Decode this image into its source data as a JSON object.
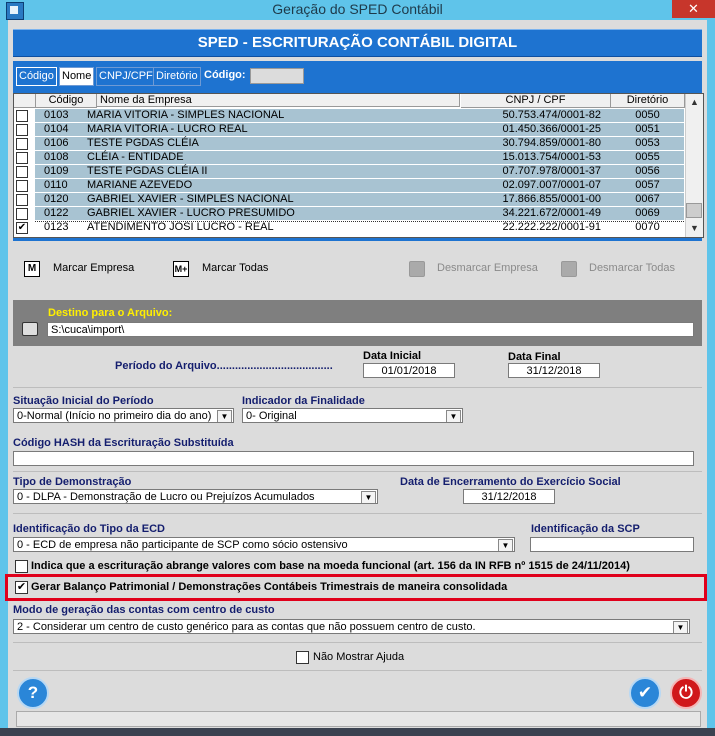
{
  "window": {
    "title": "Geração do SPED Contábil",
    "close_glyph": "✕"
  },
  "banner": "SPED - ESCRITURAÇÃO CONTÁBIL DIGITAL",
  "tabs": [
    {
      "label": "Código"
    },
    {
      "label": "Nome"
    },
    {
      "label": "CNPJ/CPF"
    },
    {
      "label": "Diretório"
    }
  ],
  "search": {
    "label": "Código:",
    "value": ""
  },
  "grid": {
    "headers": [
      "Código",
      "Nome da Empresa",
      "CNPJ / CPF",
      "Diretório"
    ],
    "rows": [
      {
        "checked": false,
        "codigo": "0103",
        "nome": "MARIA VITORIA - SIMPLES NACIONAL",
        "cnpj": "50.753.474/0001-82",
        "dir": "0050"
      },
      {
        "checked": false,
        "codigo": "0104",
        "nome": "MARIA VITORIA - LUCRO REAL",
        "cnpj": "01.450.366/0001-25",
        "dir": "0051"
      },
      {
        "checked": false,
        "codigo": "0106",
        "nome": "TESTE PGDAS CLÉIA",
        "cnpj": "30.794.859/0001-80",
        "dir": "0053"
      },
      {
        "checked": false,
        "codigo": "0108",
        "nome": "CLÉIA - ENTIDADE",
        "cnpj": "15.013.754/0001-53",
        "dir": "0055"
      },
      {
        "checked": false,
        "codigo": "0109",
        "nome": "TESTE PGDAS CLÉIA II",
        "cnpj": "07.707.978/0001-37",
        "dir": "0056"
      },
      {
        "checked": false,
        "codigo": "0110",
        "nome": "MARIANE AZEVEDO",
        "cnpj": "02.097.007/0001-07",
        "dir": "0057"
      },
      {
        "checked": false,
        "codigo": "0120",
        "nome": "GABRIEL XAVIER - SIMPLES NACIONAL",
        "cnpj": "17.866.855/0001-00",
        "dir": "0067"
      },
      {
        "checked": false,
        "codigo": "0122",
        "nome": "GABRIEL XAVIER - LUCRO PRESUMIDO",
        "cnpj": "34.221.672/0001-49",
        "dir": "0069"
      },
      {
        "checked": true,
        "codigo": "0123",
        "nome": "ATENDIMENTO JOSI LUCRO - REAL",
        "cnpj": "22.222.222/0001-91",
        "dir": "0070"
      }
    ]
  },
  "actions": {
    "marcar_empresa": "Marcar Empresa",
    "marcar_todas": "Marcar Todas",
    "desmarcar_empresa": "Desmarcar Empresa",
    "desmarcar_todas": "Desmarcar Todas",
    "m_glyph": "M",
    "mplus_glyph": "M+"
  },
  "destino": {
    "label": "Destino para o Arquivo:",
    "value": "S:\\cuca\\import\\"
  },
  "periodo": {
    "label": "Período do Arquivo......................................",
    "inicial_label": "Data Inicial",
    "inicial": "01/01/2018",
    "final_label": "Data Final",
    "final": "31/12/2018"
  },
  "situacao": {
    "label": "Situação Inicial do Período",
    "value": "0-Normal (Início no primeiro dia do ano)"
  },
  "finalidade": {
    "label": "Indicador da Finalidade",
    "value": "0- Original"
  },
  "hash": {
    "label": "Código HASH da Escrituração Substituída",
    "value": ""
  },
  "demonstracao": {
    "label": "Tipo de Demonstração",
    "value": "0 - DLPA - Demonstração de Lucro ou Prejuízos Acumulados"
  },
  "encerramento": {
    "label": "Data de Encerramento do Exercício Social",
    "value": "31/12/2018"
  },
  "ecd": {
    "label": "Identificação do Tipo da ECD",
    "value": "0 - ECD de empresa não participante de SCP como sócio ostensivo"
  },
  "scp": {
    "label": "Identificação da SCP",
    "value": ""
  },
  "moeda_funcional": {
    "label": "Indica que a escrituração abrange valores com base na moeda funcional (art. 156 da IN RFB nº 1515 de 24/11/2014)",
    "checked": false
  },
  "balanco": {
    "label": "Gerar Balanço Patrimonial / Demonstrações Contábeis Trimestrais de maneira consolidada",
    "checked": true,
    "check_glyph": "✔"
  },
  "centro_custo": {
    "label": "Modo de geração das contas com centro de custo",
    "value": "2 - Considerar um centro de custo genérico para as contas que não possuem centro de custo."
  },
  "ajuda": {
    "label": "Não Mostrar Ajuda",
    "checked": false
  },
  "footer": {
    "help_glyph": "?",
    "ok_glyph": "✔",
    "power_glyph": "⏻"
  },
  "icons": {
    "app": "sped-app-icon",
    "close": "close-icon",
    "printer": "printer-icon",
    "dropdown": "chevron-down-icon",
    "scroll_up": "chevron-up-icon",
    "scroll_down": "chevron-down-icon"
  },
  "colors": {
    "title_bg": "#5fc4ea",
    "banner_bg": "#1e73d0",
    "label_text": "#141e6e",
    "destino_label": "#ffef00",
    "highlight_frame": "#e0001b",
    "close_btn": "#c7362b",
    "help_btn": "#2a86d8",
    "ok_btn": "#2a86d8",
    "power_btn": "#d0181b"
  }
}
